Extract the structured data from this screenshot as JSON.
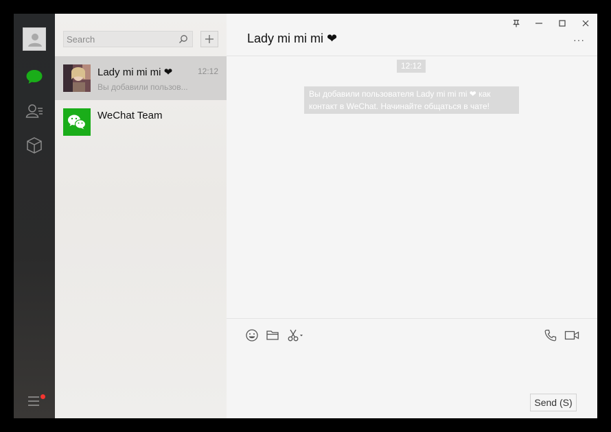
{
  "search": {
    "placeholder": "Search"
  },
  "conversations": [
    {
      "name": "Lady mi mi mi ❤",
      "time": "12:12",
      "preview": "Вы добавили пользов..."
    },
    {
      "name": "WeChat Team",
      "time": "",
      "preview": ""
    }
  ],
  "chat": {
    "title": "Lady mi mi mi ❤",
    "more": "···",
    "timestamp": "12:12",
    "system_message": "Вы добавили пользователя Lady mi mi mi ❤ как контакт в WeChat. Начинайте общаться в чате!",
    "send_label": "Send (S)"
  },
  "icons": {
    "rail": [
      "avatar-icon",
      "chat-icon",
      "contacts-icon",
      "favorites-icon",
      "menu-icon"
    ],
    "composer": [
      "emoji-icon",
      "folder-icon",
      "scissors-icon",
      "phone-icon",
      "video-icon"
    ],
    "window": [
      "pin-icon",
      "minimize-icon",
      "maximize-icon",
      "close-icon"
    ]
  },
  "colors": {
    "accent": "#1aad19",
    "notification": "#f43530",
    "rail": "#2b2b2b"
  }
}
